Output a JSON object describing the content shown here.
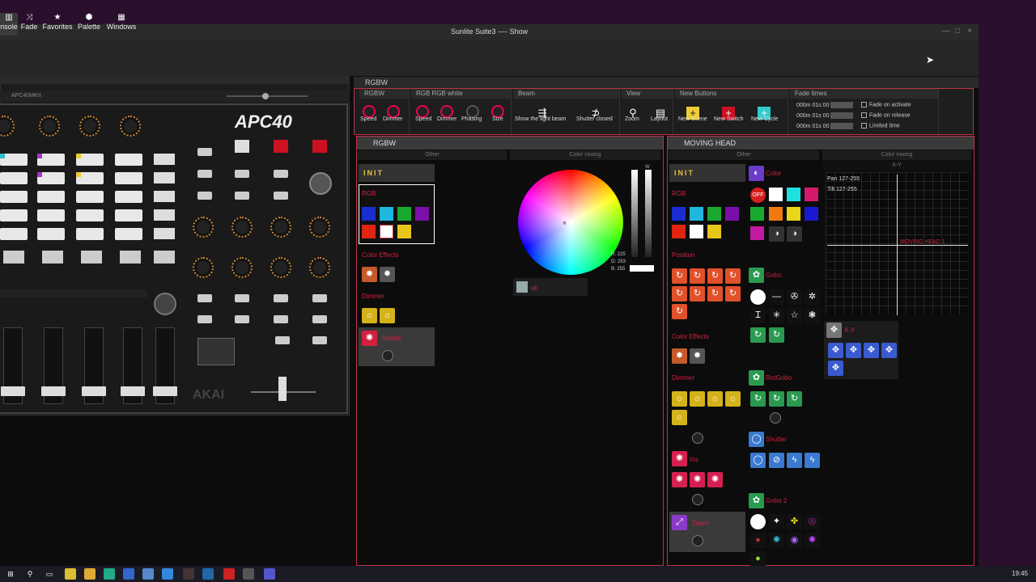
{
  "window": {
    "title": "Sunlite Suite3 ---- Show",
    "min": "—",
    "max": "□",
    "close": "×"
  },
  "menu": [
    {
      "label": "nsole",
      "icon": "▥"
    },
    {
      "label": "Fade",
      "icon": "⤨"
    },
    {
      "label": "Favorites",
      "icon": "★"
    },
    {
      "label": "Palette",
      "icon": "⬢"
    },
    {
      "label": "Windows",
      "icon": "▦"
    }
  ],
  "console": {
    "device": "APC40MKII",
    "logo": "APC40",
    "brand": "AKAI"
  },
  "rgbw_window": {
    "title": "RGBW"
  },
  "toolbar": {
    "rgbw": {
      "header": "RGBW",
      "buttons": [
        "Speed",
        "Dimmer"
      ]
    },
    "rgbrgbwhite": {
      "header": "RGB RGB white",
      "buttons": [
        "Speed",
        "Dimmer",
        "Phasing",
        "Size"
      ]
    },
    "beam": {
      "header": "Beam",
      "buttons": [
        "Show the light beam",
        "Shutter closed"
      ]
    },
    "view": {
      "header": "View",
      "buttons": [
        "Zoom",
        "Layout"
      ]
    },
    "newbuttons": {
      "header": "New Buttons",
      "buttons": [
        "New Scene",
        "New Switch",
        "New Cycle"
      ]
    },
    "fadetimes": {
      "header": "Fade times",
      "rows": [
        "000m 01s 00",
        "000m 01s 00",
        "000m 01s 00"
      ],
      "options": [
        "Fade on activate",
        "Fade on release",
        "Limited time"
      ]
    }
  },
  "rgbw_panel": {
    "title": "RGBW",
    "col_other": "Other",
    "col_mixing": "Color mixing",
    "init": "INIT",
    "rgb": "RGB",
    "color_effects": "Color Effects",
    "dimmer": "Dimmer",
    "strobe": "Strobe",
    "all_label": "all",
    "rgb_readout": {
      "r": "R: 225",
      "g": "G: 253",
      "b": "B: 255"
    },
    "slider_label": "W"
  },
  "moving_head_panel": {
    "title": "MOVING HEAD",
    "col_other": "Other",
    "col_mixing": "Color mixing",
    "xy_header": "X-Y",
    "init": "INIT",
    "color": "Color",
    "off": "OFF",
    "rgb": "RGB",
    "position": "Position",
    "color_effects": "Color Effects",
    "dimmer": "Dimmer",
    "iris": "Iris",
    "zoom": "Zoom",
    "gobo": "Gobo",
    "rotgobo": "RotGobo",
    "shutter": "Shutter",
    "gobo2": "Gobo 2",
    "pan": "Pan 127-255",
    "tilt": "Tilt 127-255",
    "head_label": "MOVING HEAD 1",
    "xy_label": "X-Y"
  },
  "taskbar": {
    "time": "19:45"
  },
  "colors": {
    "accent": "#c03048",
    "init": "#e3c23a"
  }
}
